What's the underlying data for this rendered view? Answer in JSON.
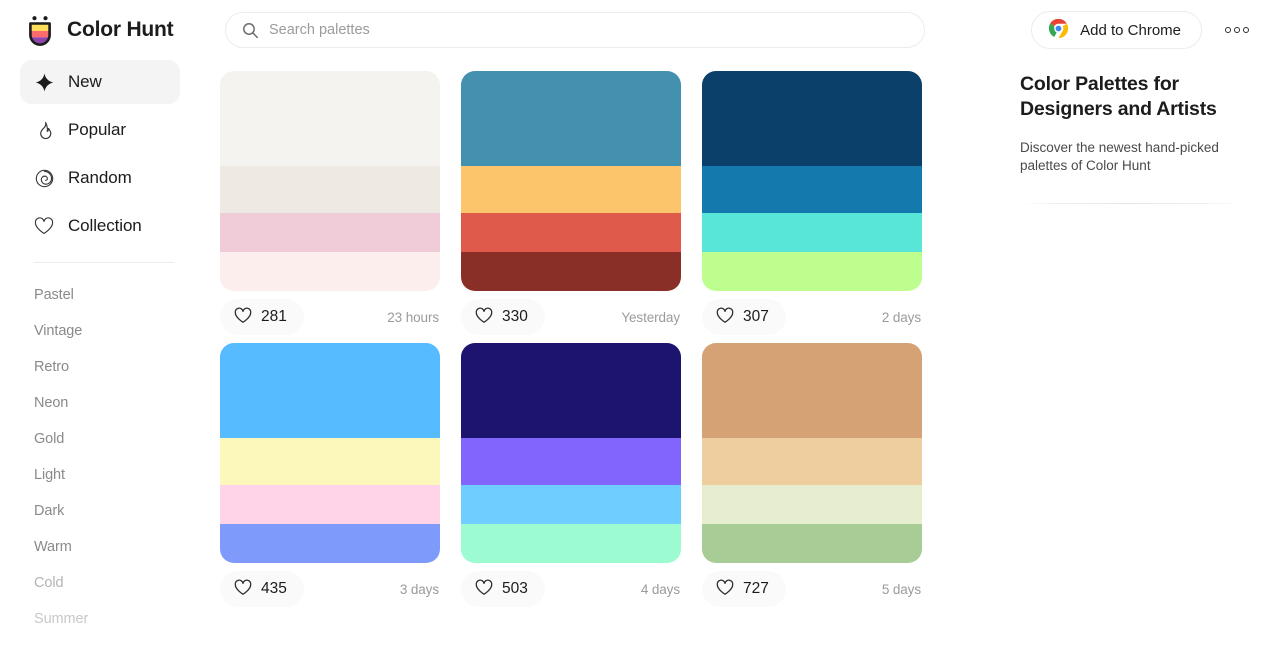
{
  "brand": {
    "name": "Color Hunt",
    "logo_icon": "colorhunt-smiley-logo",
    "logo_colors": [
      "#ffde59",
      "#ff6b6b",
      "#8e44ad"
    ]
  },
  "search": {
    "placeholder": "Search palettes",
    "value": "",
    "icon": "search-icon"
  },
  "topbar": {
    "chrome_button": {
      "label": "Add to Chrome",
      "icon": "chrome-icon"
    },
    "more_button": {
      "icon": "more-options-icon",
      "label": ""
    }
  },
  "sidebar": {
    "nav": [
      {
        "label": "New",
        "icon": "sparkle-icon",
        "active": true
      },
      {
        "label": "Popular",
        "icon": "flame-icon",
        "active": false
      },
      {
        "label": "Random",
        "icon": "spiral-icon",
        "active": false
      },
      {
        "label": "Collection",
        "icon": "heart-icon",
        "active": false
      }
    ],
    "tags": [
      "Pastel",
      "Vintage",
      "Retro",
      "Neon",
      "Gold",
      "Light",
      "Dark",
      "Warm",
      "Cold",
      "Summer"
    ]
  },
  "info_panel": {
    "title": "Color Palettes for Designers and Artists",
    "subtitle": "Discover the newest hand-picked palettes of Color Hunt"
  },
  "palettes": [
    {
      "colors": [
        "#f5f3ef",
        "#eeeae3",
        "#f0ccd8",
        "#fdeeee"
      ],
      "likes": "281",
      "time": "23 hours",
      "like_icon": "heart-icon"
    },
    {
      "colors": [
        "#4391ae",
        "#fdc56b",
        "#e05a4c",
        "#8a2f27"
      ],
      "likes": "330",
      "time": "Yesterday",
      "like_icon": "heart-icon"
    },
    {
      "colors": [
        "#0a4069",
        "#1479ad",
        "#58e6d9",
        "#befe8e"
      ],
      "likes": "307",
      "time": "2 days",
      "like_icon": "heart-icon"
    },
    {
      "colors": [
        "#57bbff",
        "#fcf8bb",
        "#ffd3e8",
        "#7e9bfb"
      ],
      "likes": "435",
      "time": "3 days",
      "like_icon": "heart-icon"
    },
    {
      "colors": [
        "#1d1470",
        "#8265fd",
        "#6fcdff",
        "#9cfbd0"
      ],
      "likes": "503",
      "time": "4 days",
      "like_icon": "heart-icon"
    },
    {
      "colors": [
        "#d5a276",
        "#eecd9f",
        "#e6eecf",
        "#a7cc96"
      ],
      "likes": "727",
      "time": "5 days",
      "like_icon": "heart-icon"
    }
  ]
}
